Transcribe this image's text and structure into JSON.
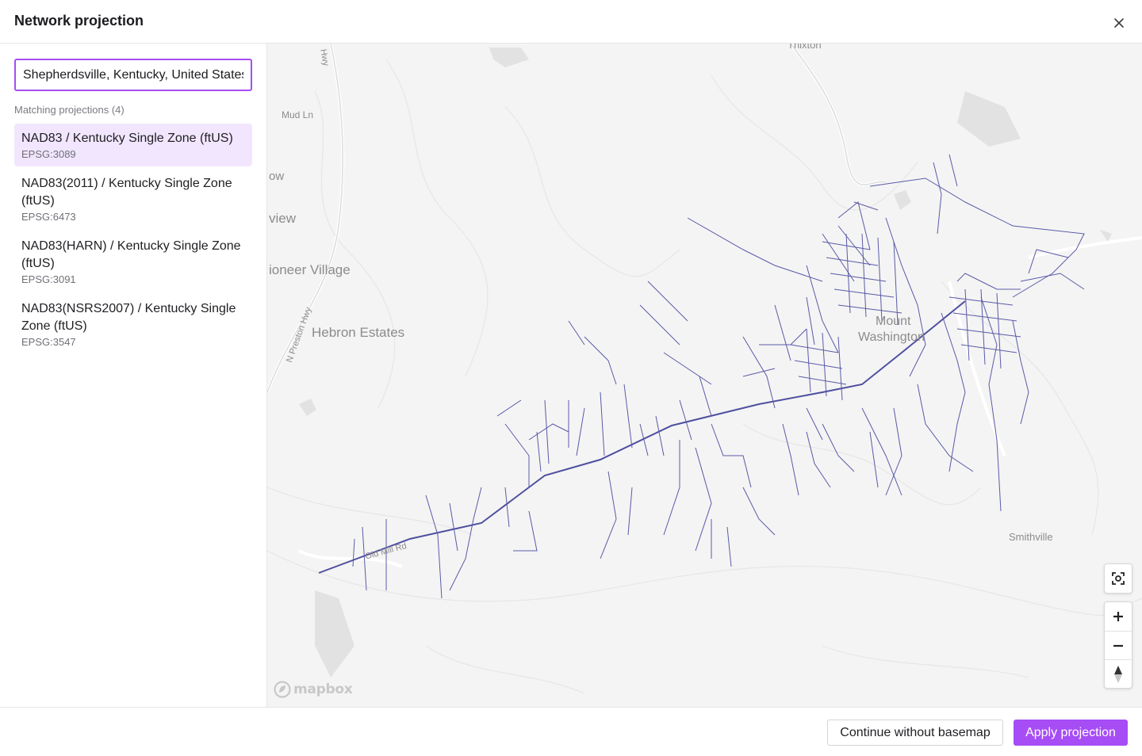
{
  "dialog": {
    "title": "Network projection",
    "close_icon": "close-icon"
  },
  "search": {
    "value": "Shepherdsville, Kentucky, United States",
    "matching_label": "Matching projections (4)"
  },
  "projections": [
    {
      "name": "NAD83 / Kentucky Single Zone (ftUS)",
      "code": "EPSG:3089",
      "selected": true
    },
    {
      "name": "NAD83(2011) / Kentucky Single Zone (ftUS)",
      "code": "EPSG:6473",
      "selected": false
    },
    {
      "name": "NAD83(HARN) / Kentucky Single Zone (ftUS)",
      "code": "EPSG:3091",
      "selected": false
    },
    {
      "name": "NAD83(NSRS2007) / Kentucky Single Zone (ftUS)",
      "code": "EPSG:3547",
      "selected": false
    }
  ],
  "map": {
    "labels": {
      "thixton": "Thixton",
      "hwy": "Hwy",
      "mud_ln": "Mud Ln",
      "low": "ow",
      "view": "view",
      "pioneer_village": "ioneer Village",
      "n_preston_hwy": "N Preston Hwy",
      "hebron_estates": "Hebron Estates",
      "mount": "Mount",
      "washington": "Washington",
      "smithville": "Smithville",
      "old_mill_rd": "Old Mill Rd"
    },
    "attribution": "mapbox",
    "network_color": "#4f4fa0",
    "controls": [
      "focus-icon",
      "zoom-in-icon",
      "zoom-out-icon",
      "compass-icon"
    ]
  },
  "footer": {
    "secondary_label": "Continue without basemap",
    "primary_label": "Apply projection"
  },
  "colors": {
    "accent": "#a64df5",
    "selected_bg": "#f1e6fd"
  }
}
